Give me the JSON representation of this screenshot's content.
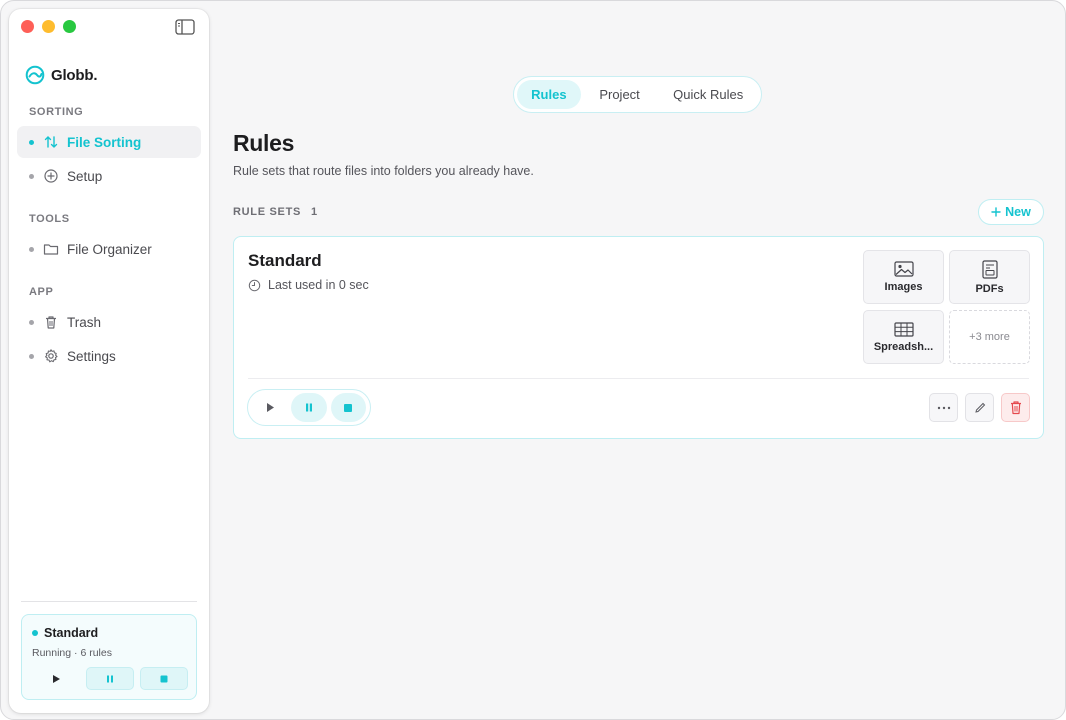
{
  "app": {
    "name": "Globb."
  },
  "sidebar": {
    "sections": [
      {
        "label": "SORTING",
        "items": [
          {
            "label": "File Sorting",
            "icon": "sort-arrows-icon",
            "active": true
          },
          {
            "label": "Setup",
            "icon": "plus-circle-icon",
            "active": false
          }
        ]
      },
      {
        "label": "TOOLS",
        "items": [
          {
            "label": "File Organizer",
            "icon": "folder-icon",
            "active": false
          }
        ]
      },
      {
        "label": "APP",
        "items": [
          {
            "label": "Trash",
            "icon": "trash-icon",
            "active": false
          },
          {
            "label": "Settings",
            "icon": "gear-icon",
            "active": false
          }
        ]
      }
    ],
    "status": {
      "title": "Standard",
      "subtitle": "Running · 6 rules"
    }
  },
  "tabs": [
    {
      "label": "Rules",
      "active": true
    },
    {
      "label": "Project",
      "active": false
    },
    {
      "label": "Quick Rules",
      "active": false
    }
  ],
  "page": {
    "title": "Rules",
    "subtitle": "Rule sets that route files into folders you already have."
  },
  "rule_sets": {
    "label": "RULE SETS",
    "count": "1",
    "new_label": "New"
  },
  "card": {
    "title": "Standard",
    "meta": "Last used in 0 sec",
    "tiles": [
      {
        "label": "Images",
        "icon": "image-icon"
      },
      {
        "label": "PDFs",
        "icon": "pdf-icon"
      },
      {
        "label": "Spreadsh...",
        "icon": "table-icon"
      }
    ],
    "more_label": "+3 more"
  },
  "colors": {
    "accent": "#14c3cf",
    "danger": "#e5484d",
    "traffic_red": "#fe5f57",
    "traffic_yellow": "#febc2e",
    "traffic_green": "#28c840"
  }
}
